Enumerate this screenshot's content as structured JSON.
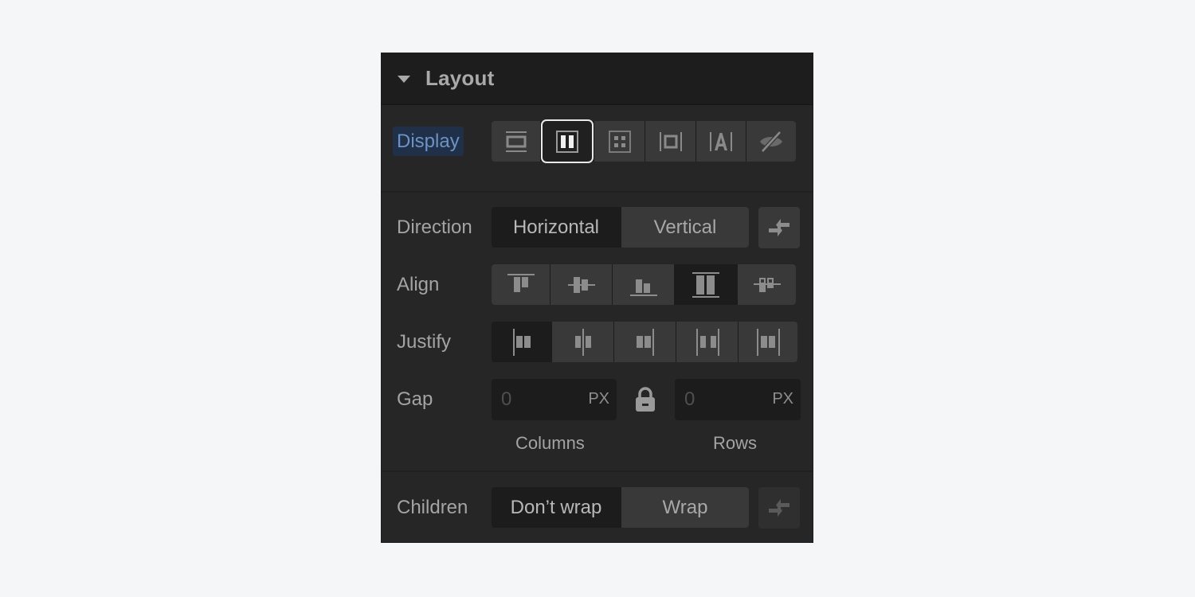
{
  "panel": {
    "title": "Layout",
    "expanded": true
  },
  "display": {
    "label": "Display",
    "options": [
      {
        "name": "block",
        "icon": "display-block-icon",
        "selected": false
      },
      {
        "name": "flex",
        "icon": "display-flex-icon",
        "selected": true
      },
      {
        "name": "grid",
        "icon": "display-grid-icon",
        "selected": false
      },
      {
        "name": "inline-block",
        "icon": "display-inline-block-icon",
        "selected": false
      },
      {
        "name": "inline",
        "icon": "display-inline-icon",
        "selected": false
      },
      {
        "name": "none",
        "icon": "display-none-icon",
        "selected": false
      }
    ]
  },
  "direction": {
    "label": "Direction",
    "options": [
      "Horizontal",
      "Vertical"
    ],
    "selected": "Horizontal",
    "reverse_icon": "reverse-arrows-icon"
  },
  "align": {
    "label": "Align",
    "options": [
      {
        "name": "start",
        "icon": "align-start-icon",
        "selected": false
      },
      {
        "name": "center",
        "icon": "align-center-icon",
        "selected": false
      },
      {
        "name": "end",
        "icon": "align-end-icon",
        "selected": false
      },
      {
        "name": "stretch",
        "icon": "align-stretch-icon",
        "selected": true
      },
      {
        "name": "baseline",
        "icon": "align-baseline-icon",
        "selected": false
      }
    ]
  },
  "justify": {
    "label": "Justify",
    "options": [
      {
        "name": "start",
        "icon": "justify-start-icon",
        "selected": true
      },
      {
        "name": "center",
        "icon": "justify-center-icon",
        "selected": false
      },
      {
        "name": "end",
        "icon": "justify-end-icon",
        "selected": false
      },
      {
        "name": "space-between",
        "icon": "justify-space-between-icon",
        "selected": false
      },
      {
        "name": "space-around",
        "icon": "justify-space-around-icon",
        "selected": false
      }
    ]
  },
  "gap": {
    "label": "Gap",
    "columns": {
      "value": "0",
      "unit": "PX",
      "label": "Columns"
    },
    "rows": {
      "value": "0",
      "unit": "PX",
      "label": "Rows"
    },
    "locked": true
  },
  "children": {
    "label": "Children",
    "options": [
      "Don’t wrap",
      "Wrap"
    ],
    "selected": "Don’t wrap",
    "reverse_icon": "reverse-arrows-icon"
  },
  "colors": {
    "panel_bg": "#262626",
    "header_bg": "#1d1d1d",
    "button_bg": "#393939",
    "active_bg": "#1c1c1c",
    "display_label_bg": "#1f3048",
    "display_label_text": "#6d92c4",
    "text": "#a4a4a4"
  }
}
